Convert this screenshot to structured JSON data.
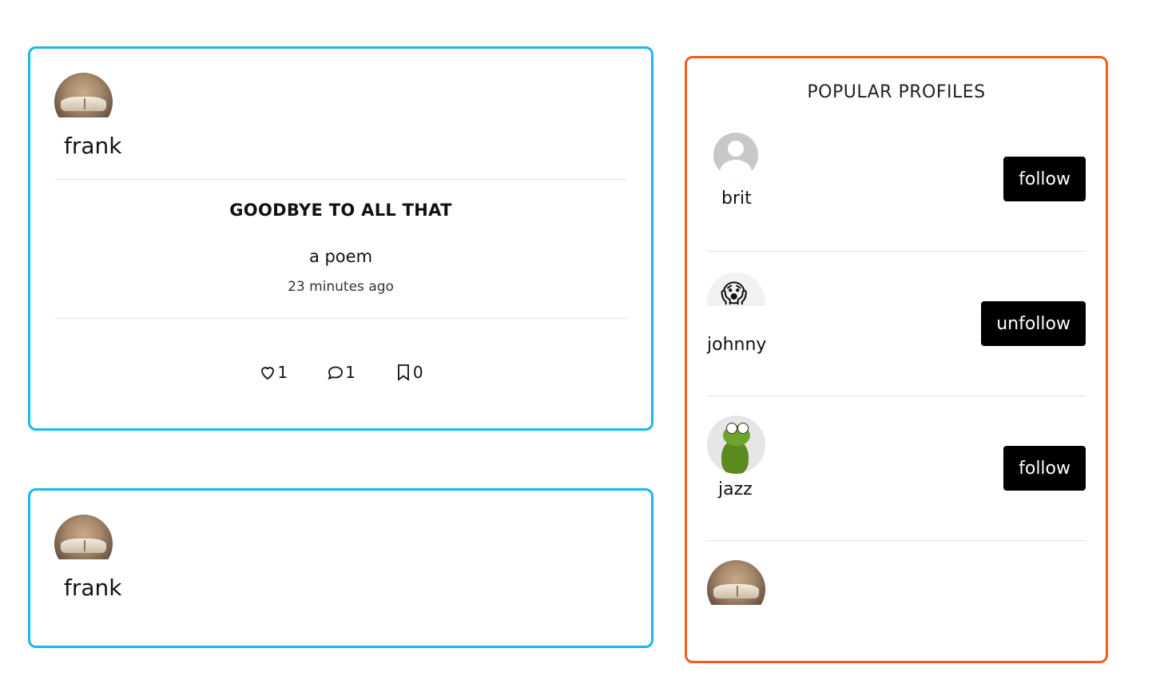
{
  "posts": [
    {
      "username": "frank",
      "title": "GOODBYE TO ALL THAT",
      "description": "a poem",
      "time": "23 minutes ago",
      "likes": "1",
      "comments": "1",
      "bookmarks": "0"
    },
    {
      "username": "frank"
    }
  ],
  "sidebar": {
    "title": "POPULAR PROFILES",
    "profiles": [
      {
        "name": "brit",
        "button": "follow",
        "avatar": "default-user-icon"
      },
      {
        "name": "johnny",
        "button": "unfollow",
        "avatar": "screaming-face-emoji"
      },
      {
        "name": "jazz",
        "button": "follow",
        "avatar": "kermit-frog-photo"
      },
      {
        "name": "",
        "button": "",
        "avatar": "open-book-photo"
      }
    ]
  },
  "colors": {
    "post_border": "#1ab8ec",
    "sidebar_border": "#f25c1e",
    "button_bg": "#000000",
    "button_text": "#ffffff"
  }
}
